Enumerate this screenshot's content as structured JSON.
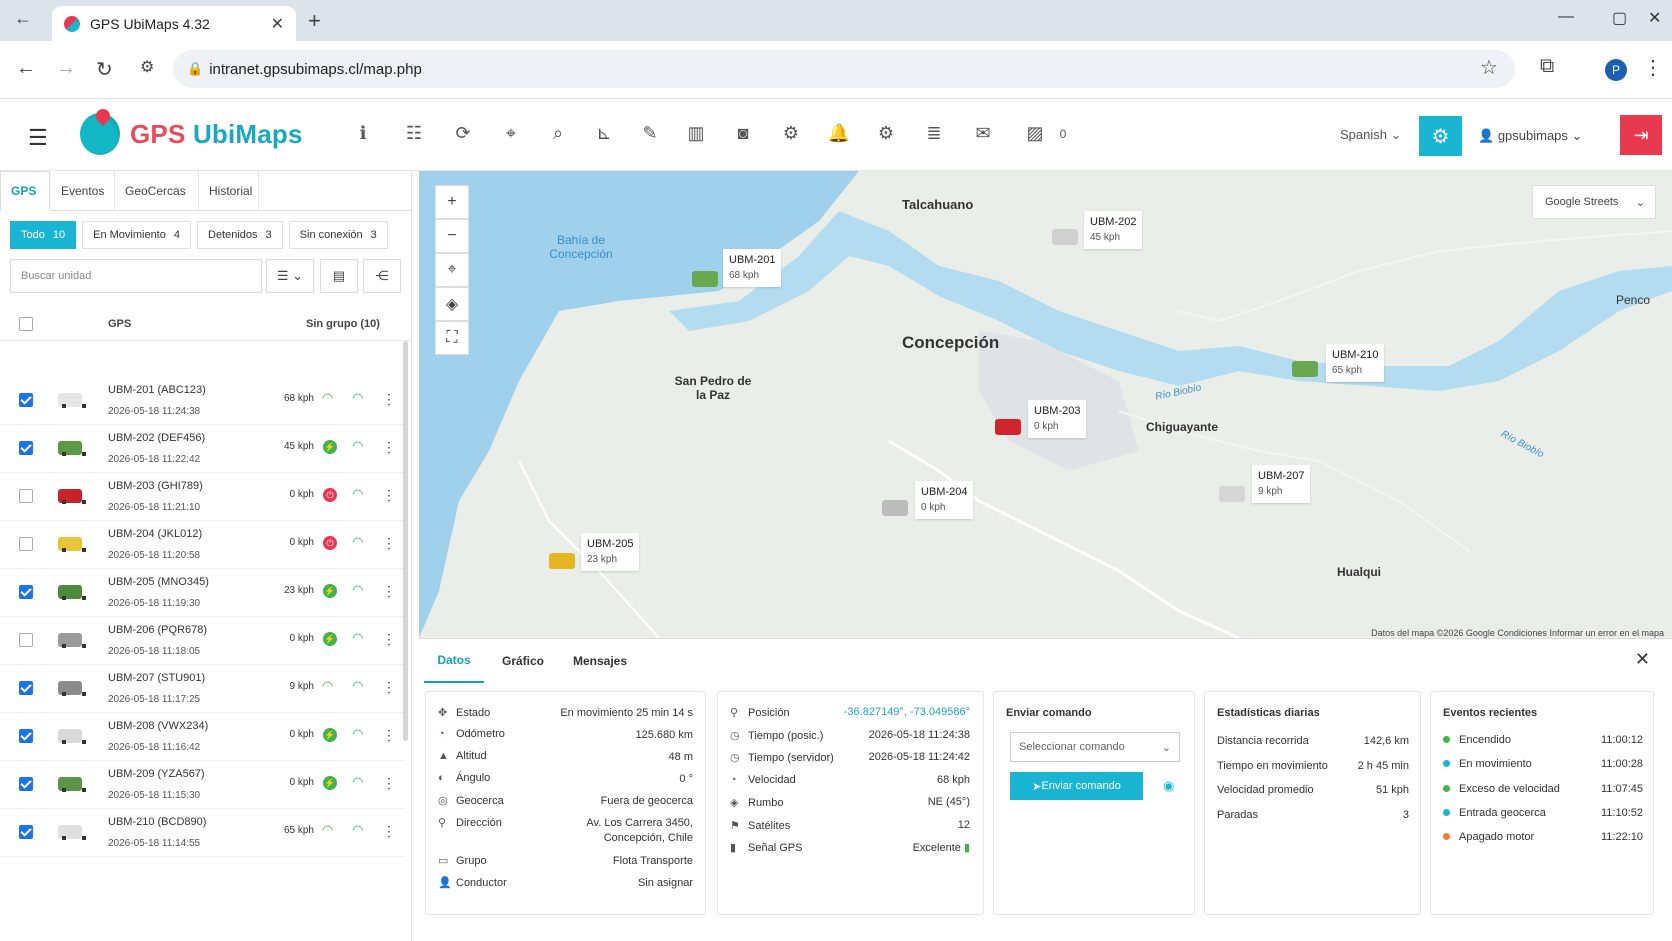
{
  "browser": {
    "tab_title": "GPS UbiMaps 4.32",
    "url": "intranet.gpsubimaps.cl/map.php",
    "profile_initial": "P"
  },
  "app": {
    "logo_text_1": "GPS ",
    "logo_text_2": "UbiMaps",
    "image_count": "0",
    "language": "Spanish",
    "username": "gpsubimaps"
  },
  "sidebar": {
    "tabs": [
      "GPS",
      "Eventos",
      "GeoCercas",
      "Historial"
    ],
    "filters": [
      {
        "label": "Todo",
        "count": "10"
      },
      {
        "label": "En Movimiento",
        "count": "4"
      },
      {
        "label": "Detenidos",
        "count": "3"
      },
      {
        "label": "Sin conexión",
        "count": "3"
      }
    ],
    "search_placeholder": "Buscar unidad",
    "col_gps": "GPS",
    "col_group": "Sin grupo (10)",
    "units": [
      {
        "name": "UBM-201 (ABC123)",
        "date": "2026-05-18 11:24:38",
        "speed": "68 kph",
        "checked": true,
        "color": "#e6e6e6",
        "status": "moving"
      },
      {
        "name": "UBM-202 (DEF456)",
        "date": "2026-05-18 11:22:42",
        "speed": "45 kph",
        "checked": true,
        "color": "#5b9a44",
        "status": "parked"
      },
      {
        "name": "UBM-203 (GHI789)",
        "date": "2026-05-18 11:21:10",
        "speed": "0 kph",
        "checked": false,
        "color": "#c8232b",
        "status": "off"
      },
      {
        "name": "UBM-204 (JKL012)",
        "date": "2026-05-18 11:20:58",
        "speed": "0 kph",
        "checked": false,
        "color": "#e8c438",
        "status": "off"
      },
      {
        "name": "UBM-205 (MNO345)",
        "date": "2026-05-18 11:19:30",
        "speed": "23 kph",
        "checked": true,
        "color": "#4d8a3a",
        "status": "parked"
      },
      {
        "name": "UBM-206 (PQR678)",
        "date": "2026-05-18 11:18:05",
        "speed": "0 kph",
        "checked": false,
        "color": "#9a9a9a",
        "status": "parked"
      },
      {
        "name": "UBM-207 (STU901)",
        "date": "2026-05-18 11:17:25",
        "speed": "9 kph",
        "checked": true,
        "color": "#8c8c8c",
        "status": "moving"
      },
      {
        "name": "UBM-208 (VWX234)",
        "date": "2026-05-18 11:16:42",
        "speed": "0 kph",
        "checked": true,
        "color": "#d8d8d8",
        "status": "parked"
      },
      {
        "name": "UBM-209 (YZA567)",
        "date": "2026-05-18 11:15:30",
        "speed": "0 kph",
        "checked": true,
        "color": "#5c9448",
        "status": "parked"
      },
      {
        "name": "UBM-210 (BCD890)",
        "date": "2026-05-18 11:14:55",
        "speed": "65 kph",
        "checked": true,
        "color": "#e0e0e0",
        "status": "moving"
      }
    ]
  },
  "map": {
    "layer": "Google Streets",
    "places": [
      "Talcahuano",
      "Bahía de Concepción",
      "Concepción",
      "San Pedro de la Paz",
      "Chiguayante",
      "Hualqui",
      "Penco",
      "Río Biobío",
      "Río Biobío"
    ],
    "units": [
      {
        "name": "UBM-201",
        "speed": "68 kph"
      },
      {
        "name": "UBM-202",
        "speed": "45 kph"
      },
      {
        "name": "UBM-210",
        "speed": "65 kph"
      },
      {
        "name": "UBM-203",
        "speed": "0 kph"
      },
      {
        "name": "UBM-204",
        "speed": "0 kph"
      },
      {
        "name": "UBM-207",
        "speed": "9 kph"
      },
      {
        "name": "UBM-205",
        "speed": "23 kph"
      }
    ],
    "attribution": [
      "Datos del mapa ©2026 Google",
      "Condiciones",
      "Informar un error en el mapa"
    ]
  },
  "detail": {
    "tabs": [
      "Datos",
      "Gráfico",
      "Mensajes"
    ],
    "left": [
      {
        "label": "Estado",
        "value": "En movimiento 25 min 14 s"
      },
      {
        "label": "Odómetro",
        "value": "125.680 km"
      },
      {
        "label": "Altitud",
        "value": "48 m"
      },
      {
        "label": "Ángulo",
        "value": "0 °"
      },
      {
        "label": "Geocerca",
        "value": "Fuera de geocerca"
      },
      {
        "label": "Dirección",
        "value": "Av. Los Carrera 3450, Concepción, Chile"
      },
      {
        "label": "Grupo",
        "value": "Flota Transporte"
      },
      {
        "label": "Conductor",
        "value": "Sin asignar"
      }
    ],
    "right": [
      {
        "label": "Posición",
        "value": "-36.827149°, -73.049586°"
      },
      {
        "label": "Tiempo (posic.)",
        "value": "2026-05-18 11:24:38"
      },
      {
        "label": "Tiempo (servidor)",
        "value": "2026-05-18 11:24:42"
      },
      {
        "label": "Velocidad",
        "value": "68 kph"
      },
      {
        "label": "Rumbo",
        "value": "NE (45°)"
      },
      {
        "label": "Satélites",
        "value": "12"
      },
      {
        "label": "Señal GPS",
        "value": "Excelente"
      }
    ],
    "command": {
      "title": "Enviar comando",
      "placeholder": "Seleccionar comando",
      "button": "Enviar comando"
    },
    "stats": {
      "title": "Estadísticas diarias",
      "rows": [
        {
          "label": "Distancia recorrida",
          "value": "142,6 km"
        },
        {
          "label": "Tiempo en movimiento",
          "value": "2 h 45 min"
        },
        {
          "label": "Velocidad promedio",
          "value": "51 kph"
        },
        {
          "label": "Paradas",
          "value": "3"
        }
      ]
    },
    "events": {
      "title": "Eventos recientes",
      "rows": [
        {
          "label": "Encendido",
          "time": "11:00:12",
          "color": "#3cb54a"
        },
        {
          "label": "En movimiento",
          "time": "11:00:28",
          "color": "#19b5d2"
        },
        {
          "label": "Exceso de velocidad",
          "time": "11:07:45",
          "color": "#3cb54a"
        },
        {
          "label": "Entrada geocerca",
          "time": "11:10:52",
          "color": "#19b5d2"
        },
        {
          "label": "Apagado motor",
          "time": "11:22:10",
          "color": "#f07f2a"
        }
      ]
    }
  }
}
